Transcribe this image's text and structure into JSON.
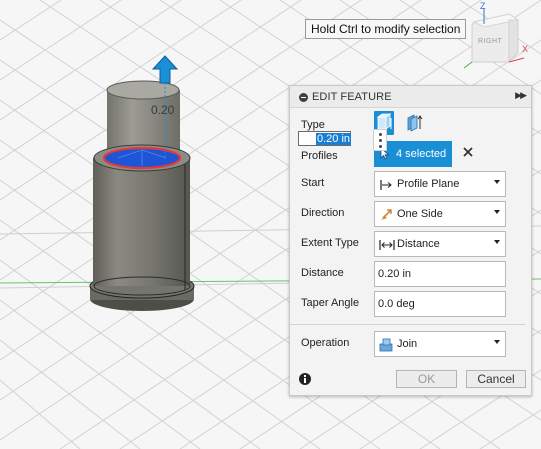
{
  "tooltip": "Hold Ctrl to modify selection",
  "viewcube": {
    "face": "RIGHT",
    "axis_z": "Z",
    "axis_x": "X"
  },
  "canvas": {
    "dimension_label": "0.20"
  },
  "panel": {
    "title": "EDIT FEATURE",
    "rows": {
      "type": {
        "label": "Type"
      },
      "profiles": {
        "label": "Profiles",
        "value": "4 selected"
      },
      "start": {
        "label": "Start",
        "value": "Profile Plane"
      },
      "direction": {
        "label": "Direction",
        "value": "One Side"
      },
      "extent_type": {
        "label": "Extent Type",
        "value": "Distance"
      },
      "distance": {
        "label": "Distance",
        "value": "0.20 in"
      },
      "taper_angle": {
        "label": "Taper Angle",
        "value": "0.0 deg"
      },
      "operation": {
        "label": "Operation",
        "value": "Join"
      }
    },
    "distance_input": "0.20 in",
    "ok_label": "OK",
    "cancel_label": "Cancel"
  },
  "colors": {
    "accent": "#1a8fd6",
    "selection_fill": "#1e55d6",
    "selection_outline": "#e03a3a",
    "grid_axis": "#6ac46a",
    "cylinder_body": "#7a7a72"
  }
}
